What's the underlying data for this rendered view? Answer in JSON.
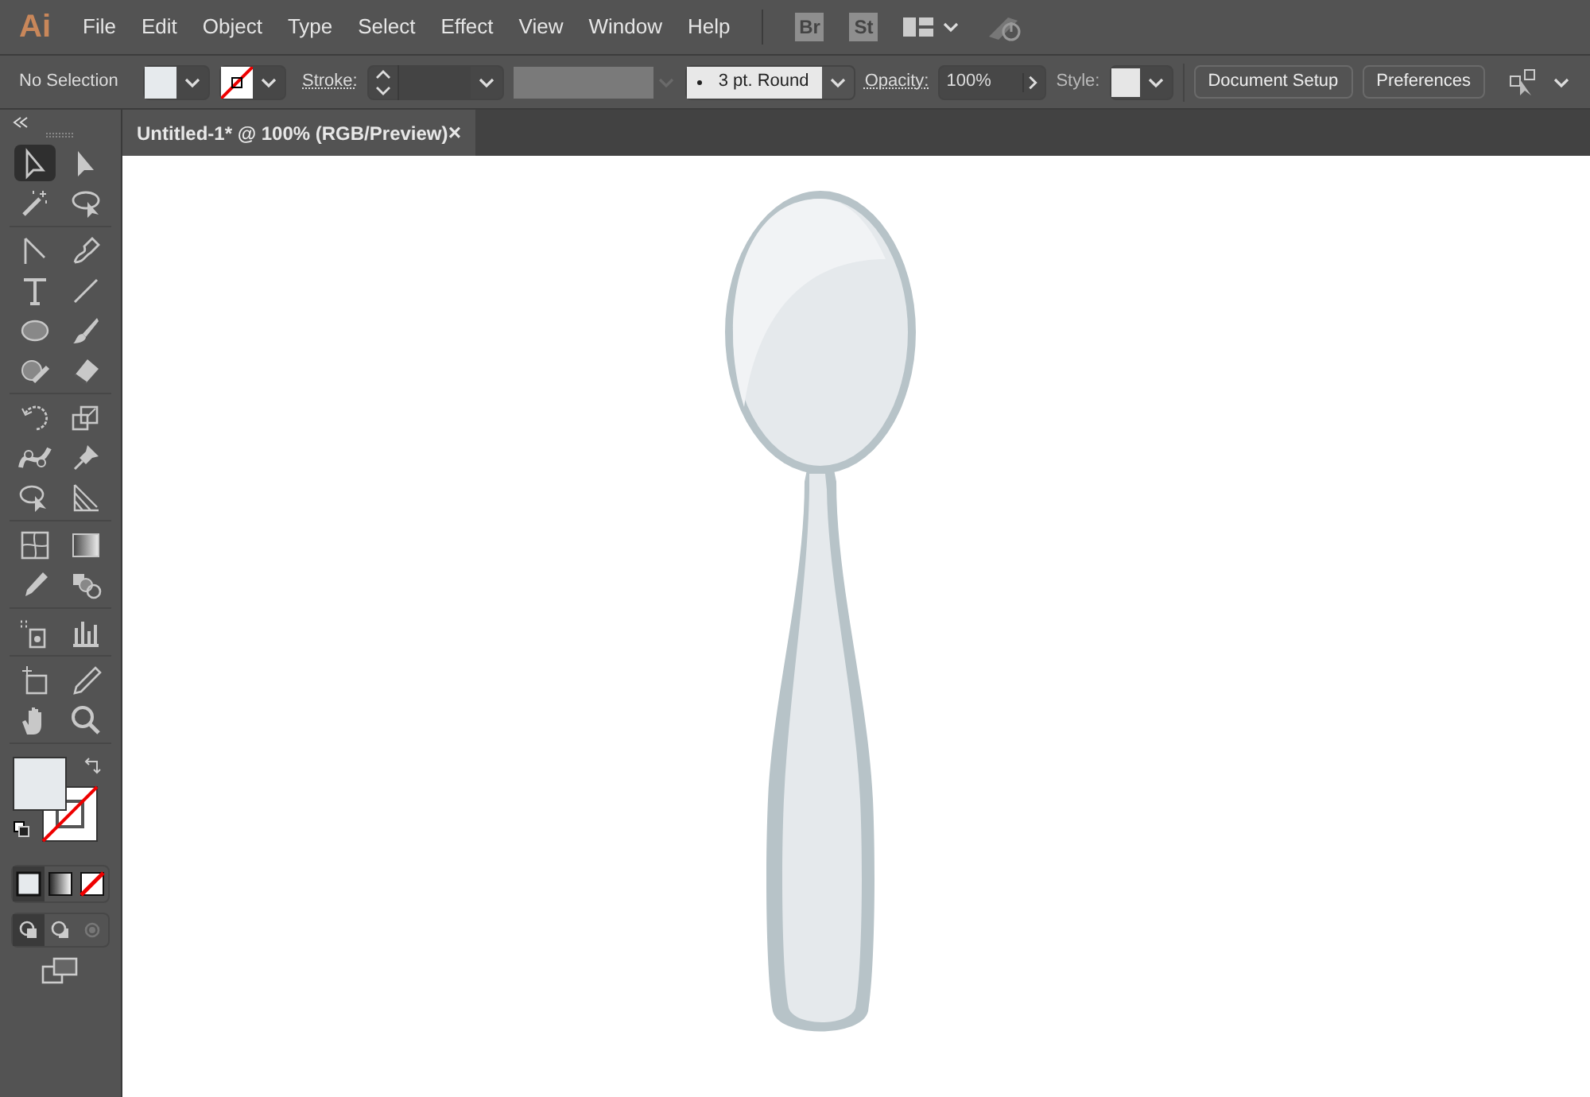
{
  "app": {
    "logo": "Ai"
  },
  "menu": [
    {
      "label": "File"
    },
    {
      "label": "Edit"
    },
    {
      "label": "Object"
    },
    {
      "label": "Type"
    },
    {
      "label": "Select"
    },
    {
      "label": "Effect"
    },
    {
      "label": "View"
    },
    {
      "label": "Window"
    },
    {
      "label": "Help"
    }
  ],
  "menu_badges": [
    {
      "label": "Br"
    },
    {
      "label": "St"
    }
  ],
  "control_bar": {
    "selection": "No Selection",
    "stroke_label": "Stroke:",
    "brush": "3 pt. Round",
    "opacity_label": "Opacity:",
    "opacity": "100%",
    "style_label": "Style:",
    "buttons": [
      "Document Setup",
      "Preferences"
    ]
  },
  "document_tab": {
    "title": "Untitled-1* @ 100% (RGB/Preview)",
    "close": "×"
  },
  "tools": [
    {
      "selected": true
    },
    {
      "selected": false
    },
    {
      "selected": false
    },
    {
      "selected": false
    },
    {
      "selected": false
    },
    {
      "selected": false
    },
    {
      "selected": false
    },
    {
      "selected": false
    },
    {
      "selected": false
    },
    {
      "selected": false
    },
    {
      "selected": false
    },
    {
      "selected": false
    },
    {
      "selected": false
    },
    {
      "selected": false
    },
    {
      "selected": false
    },
    {
      "selected": false
    },
    {
      "selected": false
    },
    {
      "selected": false
    },
    {
      "selected": false
    },
    {
      "selected": false
    },
    {
      "selected": false
    },
    {
      "selected": false
    },
    {
      "selected": false
    },
    {
      "selected": false
    },
    {
      "selected": false
    },
    {
      "selected": false
    },
    {
      "selected": false
    },
    {
      "selected": false
    }
  ],
  "color_modes": [
    {
      "selected": true
    },
    {
      "selected": false
    },
    {
      "selected": false
    }
  ],
  "draw_modes": [
    {
      "selected": true
    },
    {
      "selected": false
    },
    {
      "selected": false
    }
  ]
}
